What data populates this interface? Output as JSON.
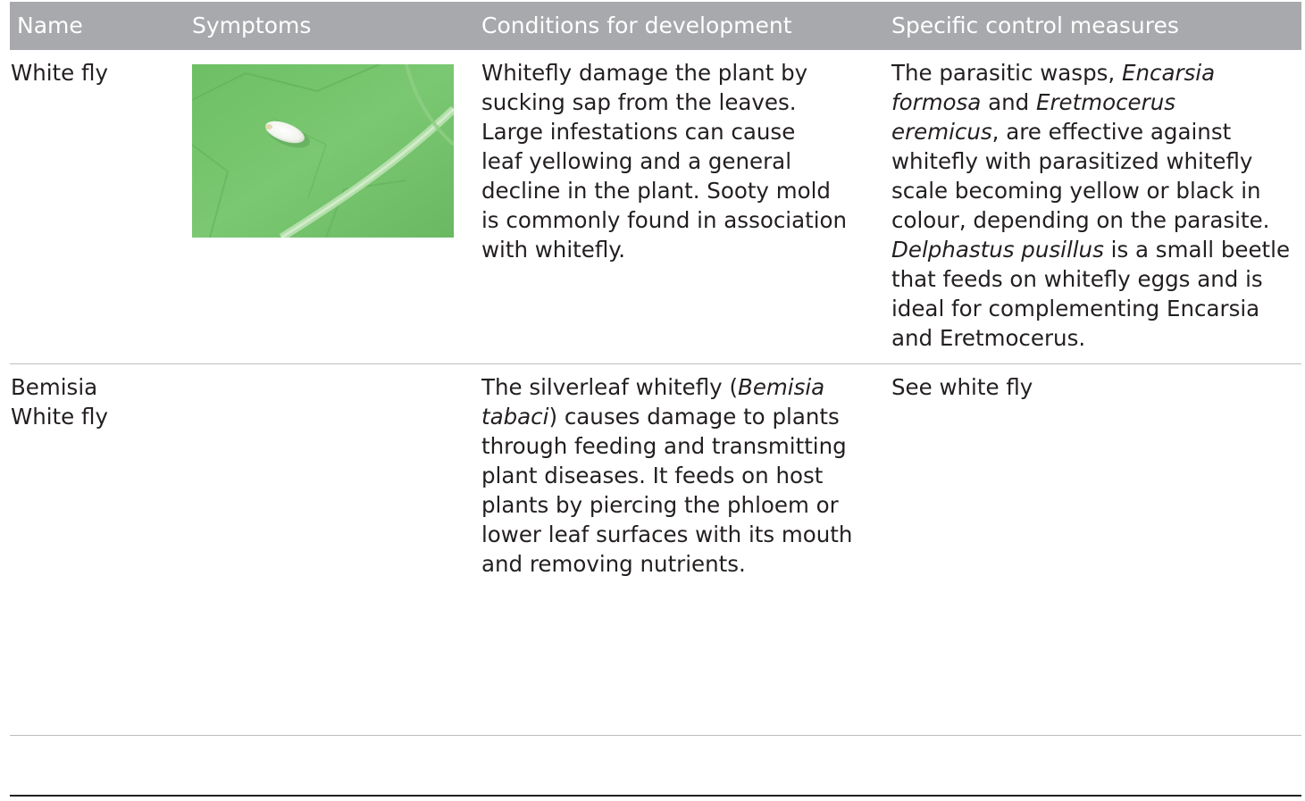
{
  "header": {
    "name": "Name",
    "symptoms": "Symptoms",
    "conditions": "Conditions for development",
    "control": "Specific control measures"
  },
  "rows": [
    {
      "name_lines": [
        "White fly"
      ],
      "symptom_image": "whitefly-on-leaf-photo",
      "conditions_lines": [
        "Whitefly damage the plant by",
        "sucking sap from the leaves.",
        "Large infestations can cause",
        "leaf yellowing and a general",
        "decline in the plant. Sooty mold",
        "is commonly found in association",
        "with whitefly."
      ],
      "control": {
        "l1_a": "The parasitic wasps, ",
        "l1_b": "Encarsia",
        "l2_a": "formosa",
        "l2_b": " and ",
        "l2_c": "Eretmocerus",
        "l3_a": "eremicus",
        "l3_b": ", are effective against",
        "l4": "whitefly with parasitized whitefly",
        "l5": "scale becoming yellow or black in",
        "l6": "colour, depending on the parasite.",
        "l7_a": "Delphastus pusillus",
        "l7_b": " is a small beetle",
        "l8": "that feeds on whitefly eggs and is",
        "l9": "ideal for complementing Encarsia",
        "l10": "and Eretmocerus."
      }
    },
    {
      "name_lines": [
        "Bemisia",
        "White fly"
      ],
      "conditions": {
        "l1_a": "The silverleaf whitefly (",
        "l1_b": "Bemisia",
        "l2_a": "tabaci",
        "l2_b": ") causes damage to plants",
        "l3": "through feeding and transmitting",
        "l4": "plant diseases. It feeds on host",
        "l5": "plants by piercing the phloem or",
        "l6": "lower leaf surfaces with its mouth",
        "l7": "and removing nutrients."
      },
      "control_lines": [
        "See white fly"
      ]
    }
  ],
  "colors": {
    "header_bg": "#a7a9ac",
    "header_text": "#ffffff",
    "body_text": "#231f20",
    "row_rule": "#bcbec0",
    "leaf_green": "#74c26b"
  }
}
